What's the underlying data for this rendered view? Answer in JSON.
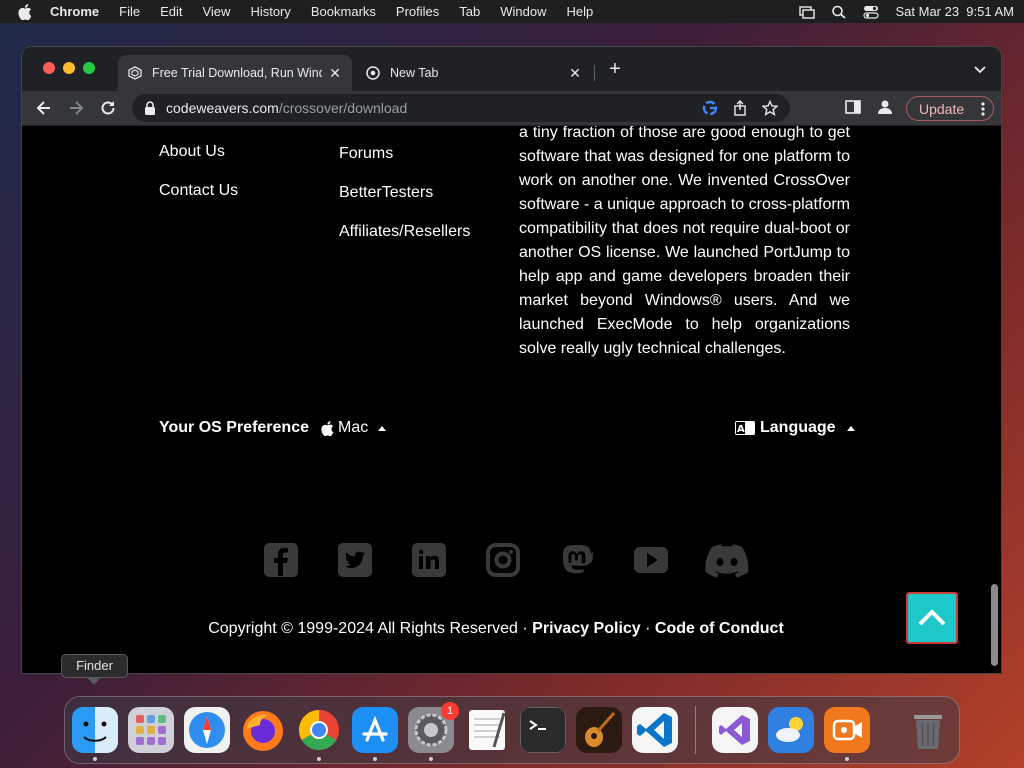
{
  "menubar": {
    "app_name": "Chrome",
    "items": [
      "File",
      "Edit",
      "View",
      "History",
      "Bookmarks",
      "Profiles",
      "Tab",
      "Window",
      "Help"
    ],
    "datetime": "Sat Mar 23  9:51 AM"
  },
  "browser": {
    "tabs": [
      {
        "title": "Free Trial Download, Run Wind",
        "icon": "codeweavers-favicon",
        "active": true
      },
      {
        "title": "New Tab",
        "icon": "chrome-icon",
        "active": false
      }
    ],
    "url_host": "codeweavers.com",
    "url_path": "/crossover/download",
    "update_label": "Update"
  },
  "page": {
    "col1_links": [
      "About Us",
      "Contact Us"
    ],
    "col2_links": [
      "Forums",
      "BetterTesters",
      "Affiliates/Resellers"
    ],
    "about_text": "a tiny fraction of those are good enough to get software that was designed for one platform to work on another one. We invented CrossOver software - a unique approach to cross-platform compatibility that does not require dual-boot or another OS license. We launched PortJump to help app and game developers broaden their market beyond Windows® users. And we launched ExecMode to help organizations solve really ugly technical challenges.",
    "os_pref_label": "Your OS Preference",
    "os_value": "Mac",
    "language_label": "Language",
    "social": [
      "facebook-icon",
      "twitter-icon",
      "linkedin-icon",
      "instagram-icon",
      "mastodon-icon",
      "youtube-icon",
      "discord-icon"
    ],
    "copyright": "Copyright © 1999-2024 All Rights Reserved · ",
    "privacy": "Privacy Policy",
    "sep": " · ",
    "conduct": "Code of Conduct",
    "accent": "#1ec8c8"
  },
  "dock": {
    "tooltip": "Finder",
    "badge": "1",
    "apps": [
      "Finder",
      "Launchpad",
      "Safari",
      "Firefox",
      "Chrome",
      "App Store",
      "System Preferences",
      "TextEdit",
      "Terminal",
      "GarageBand",
      "Visual Studio Code",
      "Visual Studio",
      "Weather",
      "Screen Recorder",
      "Trash"
    ]
  }
}
